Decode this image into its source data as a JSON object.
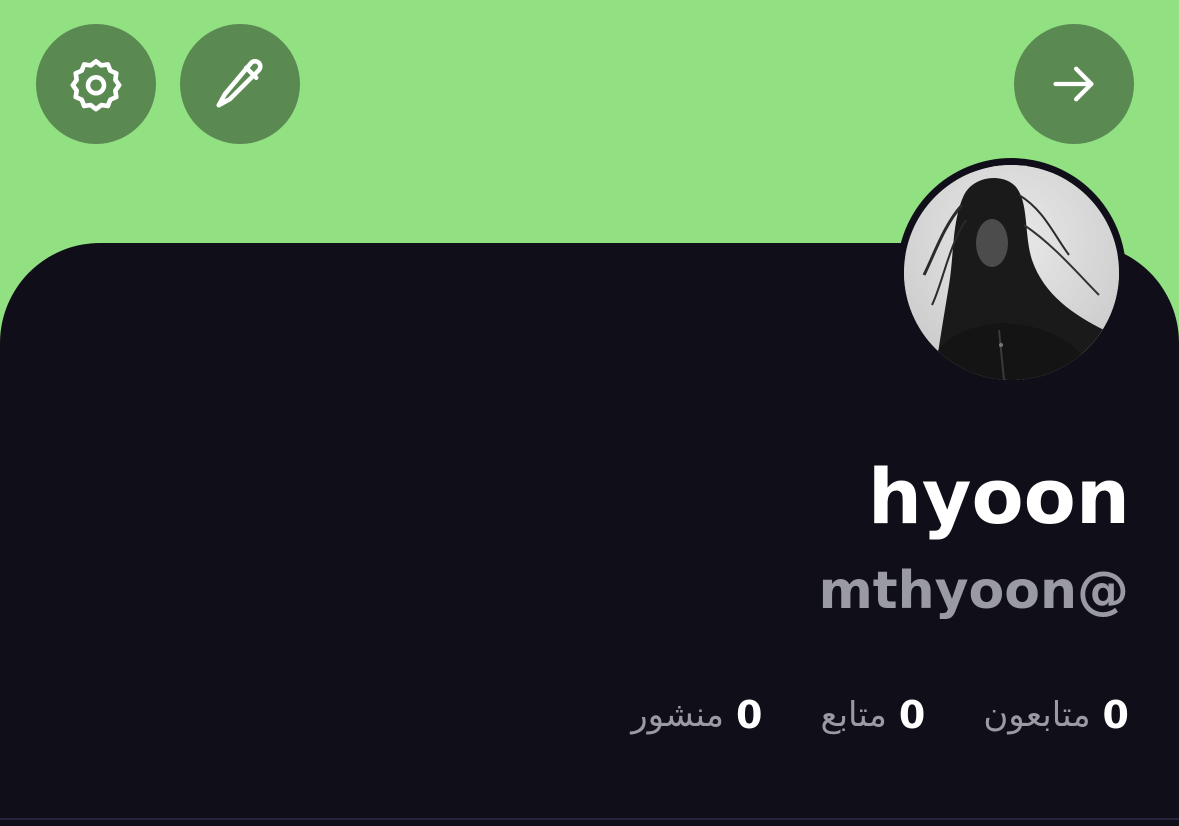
{
  "header": {
    "settings_icon": "gear-icon",
    "edit_icon": "pencil-icon",
    "forward_icon": "arrow-right-icon",
    "background_color": "#91e082",
    "button_color": "#5a8a52"
  },
  "profile": {
    "display_name": "hyoon",
    "handle": "mthyoon@",
    "avatar": "profile-photo",
    "card_color": "#100f19"
  },
  "stats": [
    {
      "count": "0",
      "label": "متابعون"
    },
    {
      "count": "0",
      "label": "متابع"
    },
    {
      "count": "0",
      "label": "منشور"
    }
  ]
}
